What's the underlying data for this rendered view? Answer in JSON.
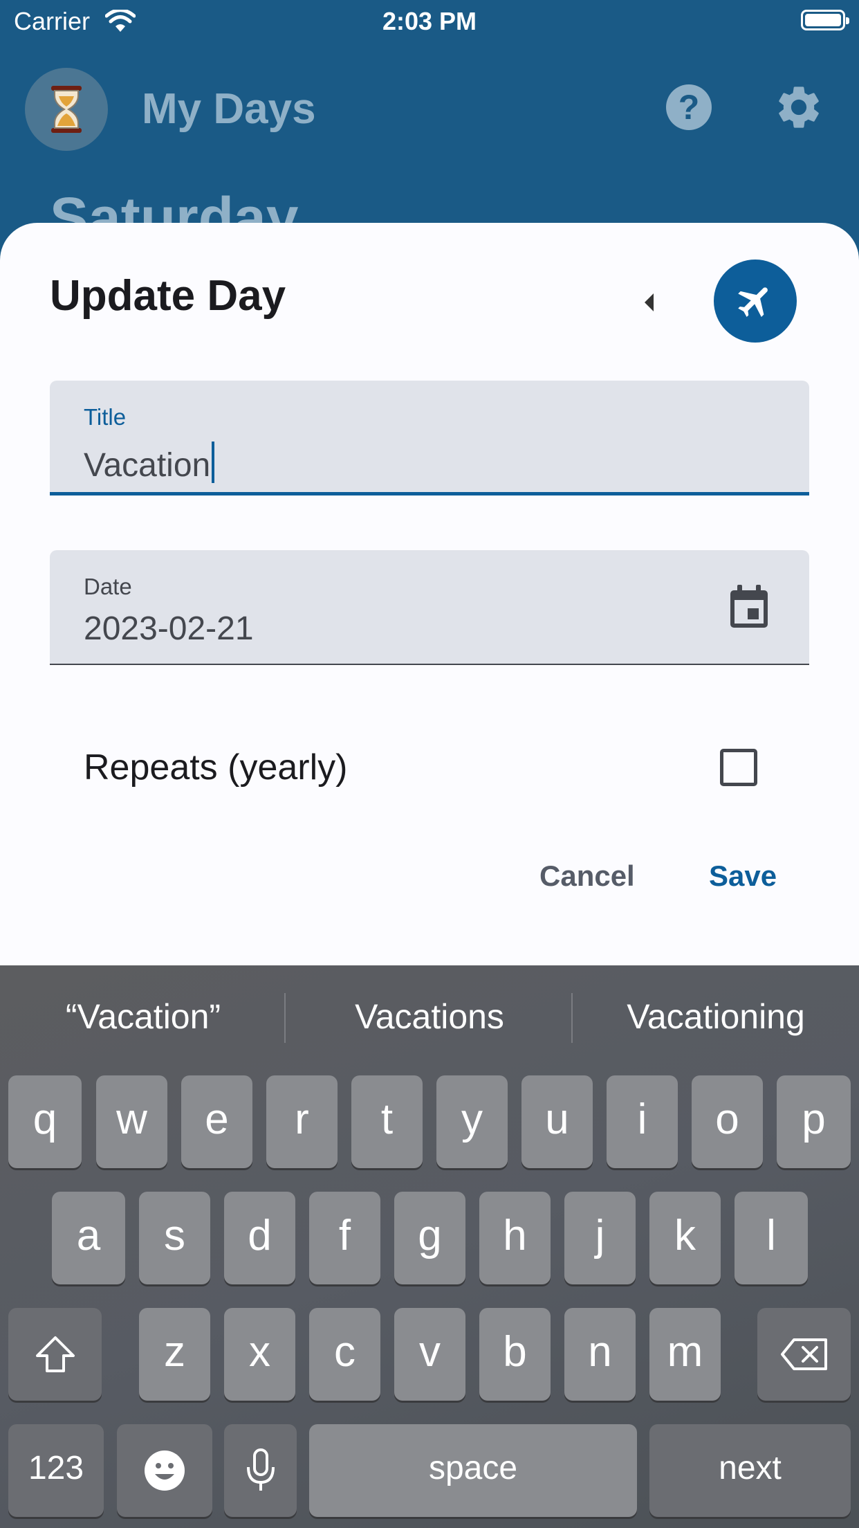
{
  "status_bar": {
    "carrier": "Carrier",
    "time": "2:03 PM"
  },
  "app_bar": {
    "title": "My Days",
    "help_symbol": "?",
    "background_heading": "Saturday"
  },
  "dialog": {
    "title": "Update Day",
    "icon": "airplane-icon",
    "title_field": {
      "label": "Title",
      "value": "Vacation"
    },
    "date_field": {
      "label": "Date",
      "value": "2023-02-21"
    },
    "repeats_label": "Repeats (yearly)",
    "repeats_checked": false,
    "cancel_label": "Cancel",
    "save_label": "Save"
  },
  "keyboard": {
    "suggestions": [
      "“Vacation”",
      "Vacations",
      "Vacationing"
    ],
    "row1": [
      "q",
      "w",
      "e",
      "r",
      "t",
      "y",
      "u",
      "i",
      "o",
      "p"
    ],
    "row2": [
      "a",
      "s",
      "d",
      "f",
      "g",
      "h",
      "j",
      "k",
      "l"
    ],
    "row3": [
      "z",
      "x",
      "c",
      "v",
      "b",
      "n",
      "m"
    ],
    "numbers_label": "123",
    "space_label": "space",
    "next_label": "next"
  },
  "colors": {
    "primary": "#0d5e9a",
    "app_bar": "#1a5a86",
    "field_bg": "#e0e3ea"
  }
}
